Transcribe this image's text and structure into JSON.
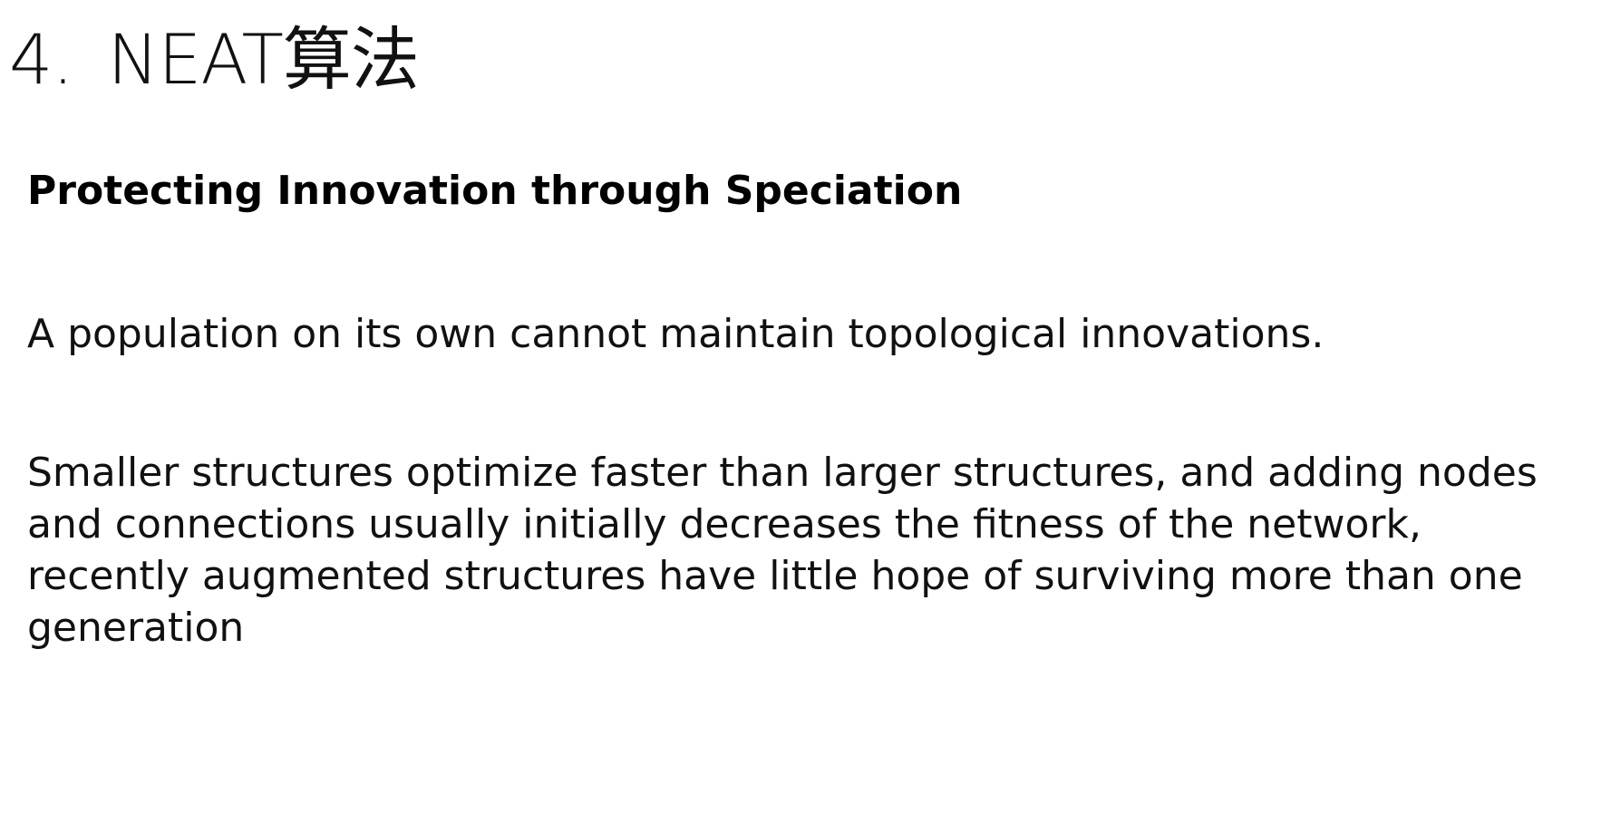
{
  "slide": {
    "title_number": "4.",
    "title_text": "NEAT算法",
    "subtitle": "Protecting Innovation through Speciation",
    "paragraph1": "A population on its own cannot maintain topological innovations.",
    "paragraph2": "Smaller structures optimize faster than larger structures, and adding nodes and connections usually initially decreases the fitness of the network, recently augmented structures have little hope of surviving more than one generation"
  }
}
